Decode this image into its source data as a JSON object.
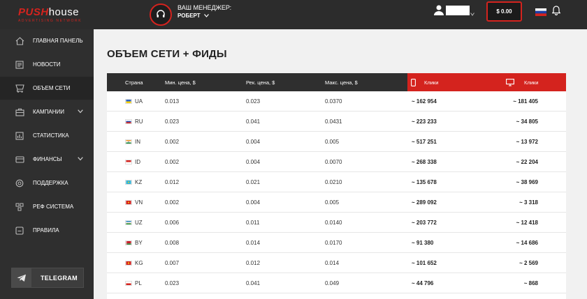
{
  "header": {
    "logo_main_a": "PUSH",
    "logo_main_b": "house",
    "logo_sub": "ADVERTISING NETWORK",
    "manager_title": "ВАШ МЕНЕДЖЕР:",
    "manager_name": "РОБЕРТ",
    "balance": "$ 0.00",
    "accent_color": "#d4231e"
  },
  "sidebar": {
    "items": [
      {
        "label": "ГЛАВНАЯ ПАНЕЛЬ",
        "icon": "home-icon"
      },
      {
        "label": "НОВОСТИ",
        "icon": "news-icon"
      },
      {
        "label": "ОБЪЕМ СЕТИ",
        "icon": "network-icon",
        "active": true
      },
      {
        "label": "КАМПАНИИ",
        "icon": "briefcase-icon",
        "has_submenu": true
      },
      {
        "label": "СТАТИСТИКА",
        "icon": "stats-icon"
      },
      {
        "label": "ФИНАНСЫ",
        "icon": "finance-icon",
        "has_submenu": true
      },
      {
        "label": "ПОДДЕРЖКА",
        "icon": "support-icon"
      },
      {
        "label": "РЕФ СИСТЕМА",
        "icon": "referral-icon"
      },
      {
        "label": "ПРАВИЛА",
        "icon": "rules-icon"
      }
    ],
    "telegram_label": "TELEGRAM"
  },
  "main": {
    "title": "ОБЪЕМ СЕТИ + ФИДЫ",
    "columns": {
      "country": "Страна",
      "min_price": "Мин. цена, $",
      "rec_price": "Рек. цена, $",
      "max_price": "Макс. цена, $",
      "mobile_clicks": "Клики",
      "desktop_clicks": "Клики"
    },
    "rows": [
      {
        "code": "UA",
        "min": "0.013",
        "rec": "0.023",
        "max": "0.0370",
        "mobile": "~ 162 954",
        "desktop": "~ 181 405"
      },
      {
        "code": "RU",
        "min": "0.023",
        "rec": "0.041",
        "max": "0.0431",
        "mobile": "~ 223 233",
        "desktop": "~ 34 805"
      },
      {
        "code": "IN",
        "min": "0.002",
        "rec": "0.004",
        "max": "0.005",
        "mobile": "~ 517 251",
        "desktop": "~ 13 972"
      },
      {
        "code": "ID",
        "min": "0.002",
        "rec": "0.004",
        "max": "0.0070",
        "mobile": "~ 268 338",
        "desktop": "~ 22 204"
      },
      {
        "code": "KZ",
        "min": "0.012",
        "rec": "0.021",
        "max": "0.0210",
        "mobile": "~ 135 678",
        "desktop": "~ 38 969"
      },
      {
        "code": "VN",
        "min": "0.002",
        "rec": "0.004",
        "max": "0.005",
        "mobile": "~ 289 092",
        "desktop": "~ 3 318"
      },
      {
        "code": "UZ",
        "min": "0.006",
        "rec": "0.011",
        "max": "0.0140",
        "mobile": "~ 203 772",
        "desktop": "~ 12 418"
      },
      {
        "code": "BY",
        "min": "0.008",
        "rec": "0.014",
        "max": "0.0170",
        "mobile": "~ 91 380",
        "desktop": "~ 14 686"
      },
      {
        "code": "KG",
        "min": "0.007",
        "rec": "0.012",
        "max": "0.014",
        "mobile": "~ 101 652",
        "desktop": "~ 2 569"
      },
      {
        "code": "PL",
        "min": "0.023",
        "rec": "0.041",
        "max": "0.049",
        "mobile": "~ 44 796",
        "desktop": "~ 868"
      }
    ]
  }
}
